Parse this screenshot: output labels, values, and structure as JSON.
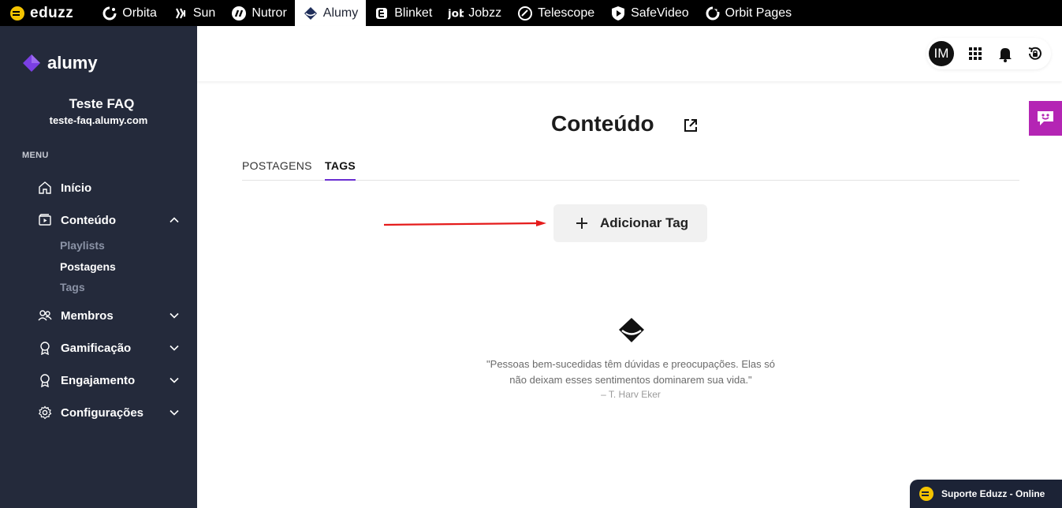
{
  "topbar": {
    "brand": "eduzz",
    "items": [
      "Orbita",
      "Sun",
      "Nutror",
      "Alumy",
      "Blinket",
      "Jobzz",
      "Telescope",
      "SafeVideo",
      "Orbit Pages"
    ],
    "active": "Alumy"
  },
  "sidebar": {
    "logo": "alumy",
    "site_name": "Teste FAQ",
    "site_url": "teste-faq.alumy.com",
    "menu_label": "MENU",
    "items": [
      {
        "label": "Início",
        "icon": "home-icon"
      },
      {
        "label": "Conteúdo",
        "icon": "play-folder-icon",
        "expanded": true,
        "children": [
          "Playlists",
          "Postagens",
          "Tags"
        ]
      },
      {
        "label": "Membros",
        "icon": "users-icon"
      },
      {
        "label": "Gamificação",
        "icon": "badge-icon"
      },
      {
        "label": "Engajamento",
        "icon": "badge-icon"
      },
      {
        "label": "Configurações",
        "icon": "gear-icon"
      }
    ],
    "active_child": "Postagens"
  },
  "header": {
    "avatar_initials": "IM"
  },
  "main": {
    "title": "Conteúdo",
    "tabs": [
      "POSTAGENS",
      "TAGS"
    ],
    "active_tab": "TAGS",
    "add_button": "Adicionar Tag",
    "quote_line1": "\"Pessoas bem-sucedidas têm dúvidas e preocupações. Elas só",
    "quote_line2": "não deixam esses sentimentos dominarem sua vida.\"",
    "quote_author": "– T. Harv Eker"
  },
  "support": {
    "label": "Suporte Eduzz - Online"
  },
  "colors": {
    "sidebar_bg": "#242a3b",
    "accent": "#6a2ed1",
    "chat_tab": "#b425b4",
    "annotation_arrow": "#e51b1b"
  }
}
